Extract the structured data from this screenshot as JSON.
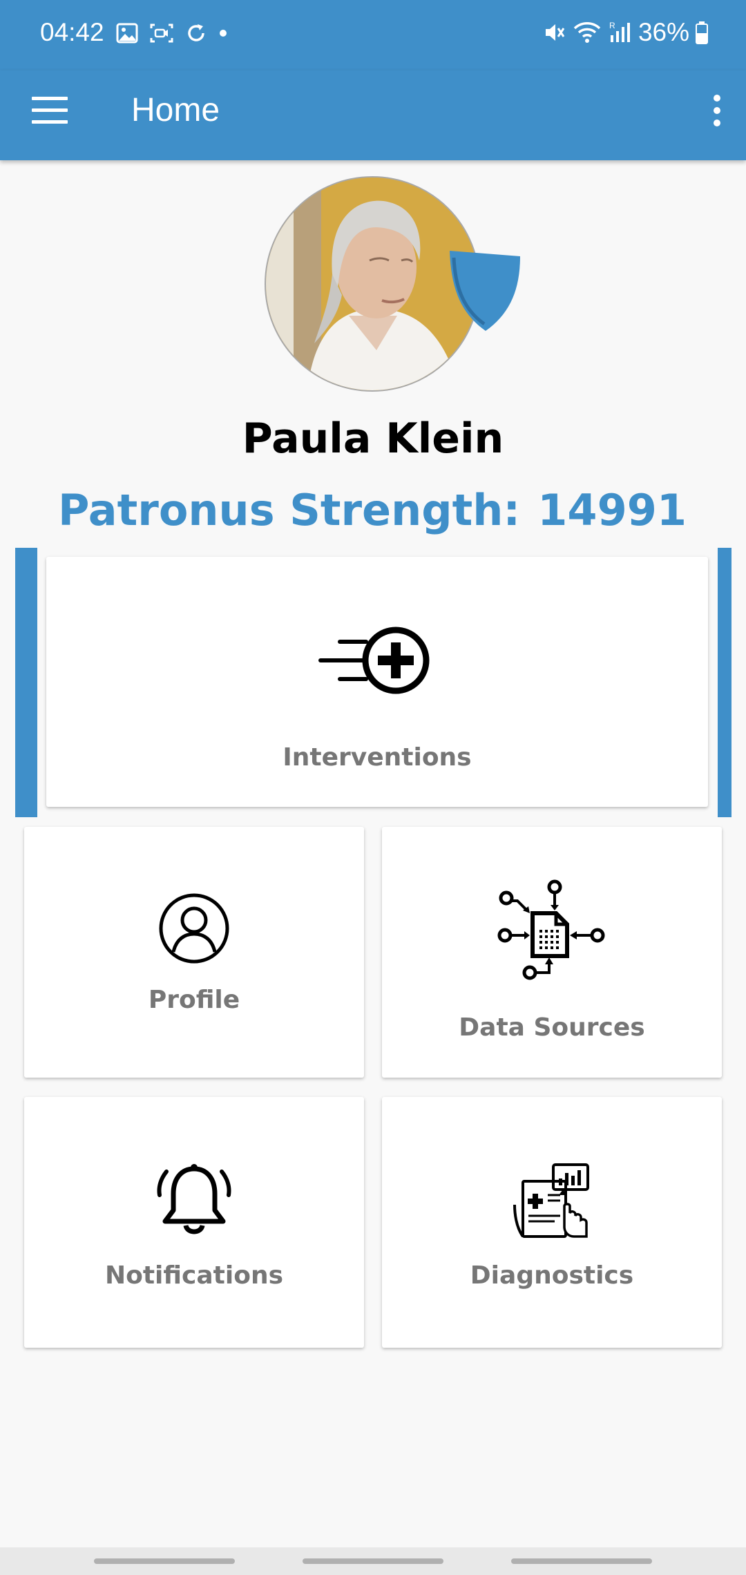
{
  "status_bar": {
    "time": "04:42",
    "battery": "36%",
    "left_icons": [
      "image-icon",
      "screen-record-icon",
      "sync-icon",
      "dot-icon"
    ],
    "right_icons": [
      "mute-icon",
      "wifi-icon",
      "signal-icon",
      "battery-icon"
    ]
  },
  "app_bar": {
    "title": "Home",
    "menu_icon": "hamburger-menu-icon",
    "overflow_icon": "more-vert-icon"
  },
  "profile": {
    "name": "Paula Klein",
    "patronus_label": "Patronus Strength:",
    "patronus_value": "14991"
  },
  "cards": {
    "interventions": {
      "label": "Interventions",
      "icon": "fast-medical-plus-icon"
    },
    "profile": {
      "label": "Profile",
      "icon": "user-circle-icon"
    },
    "data_sources": {
      "label": "Data Sources",
      "icon": "data-network-document-icon"
    },
    "notifications": {
      "label": "Notifications",
      "icon": "bell-ringing-icon"
    },
    "diagnostics": {
      "label": "Diagnostics",
      "icon": "medical-report-chart-icon"
    }
  },
  "colors": {
    "primary": "#3f8fc9",
    "label_gray": "#767676",
    "background": "#f8f8f8"
  }
}
